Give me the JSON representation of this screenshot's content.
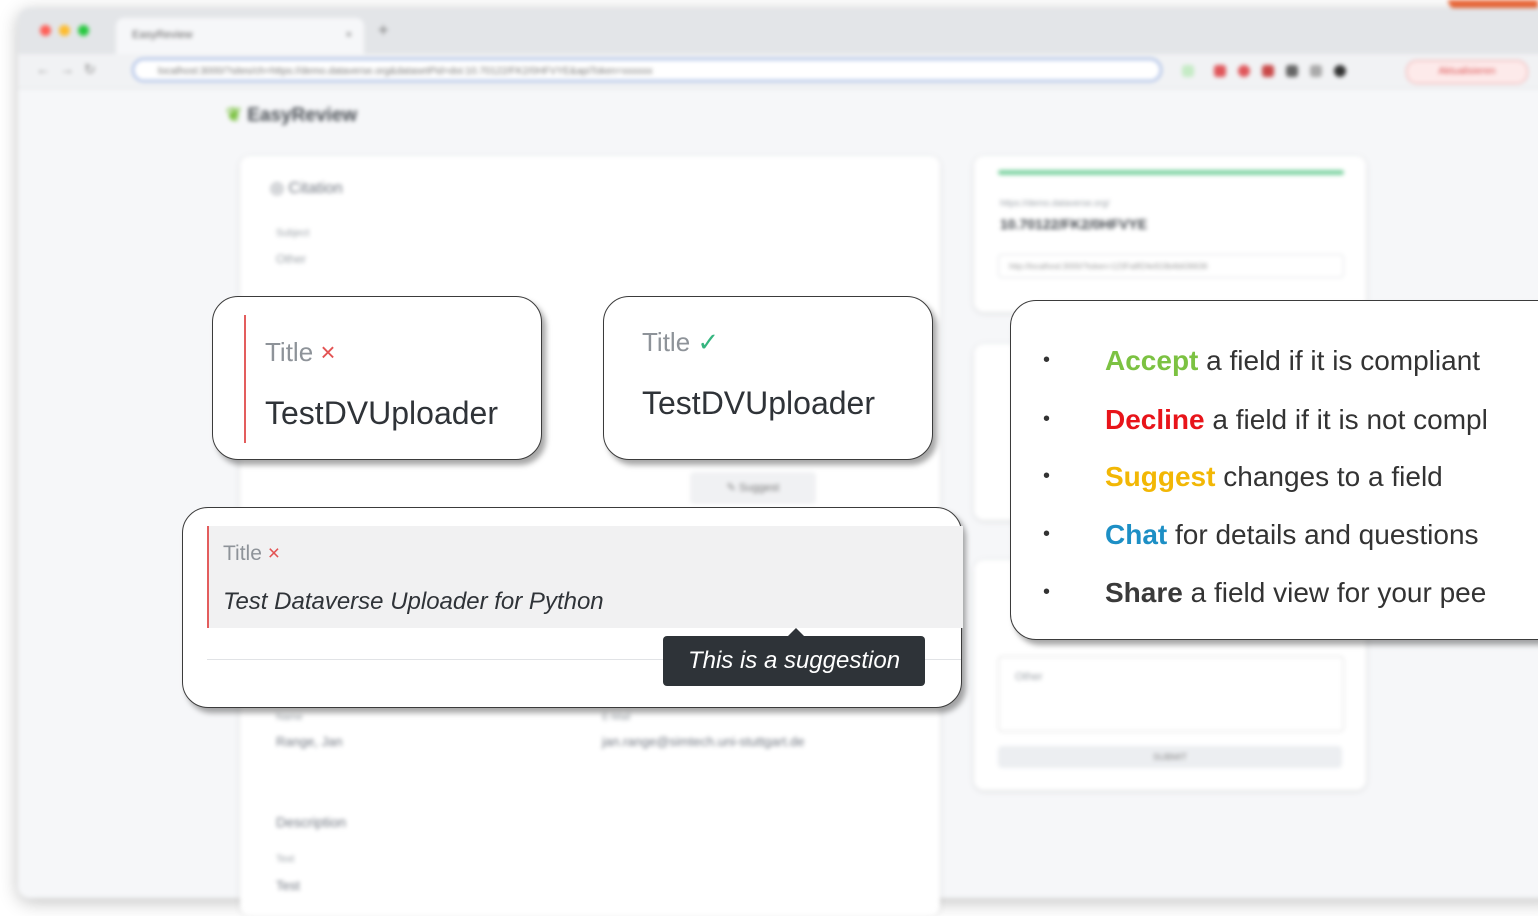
{
  "browser": {
    "tab_title": "EasyReview",
    "tab_close": "×",
    "new_tab": "+",
    "url": "localhost:3000/?sites/ch=https://demo.dataverse.org&datasetPid=doi:10.70122/FK2/0HFVYE&apiToken=xxxxxx",
    "update_label": "Aktualisieren",
    "traffic_colors": [
      "#ff5f57",
      "#febc2e",
      "#28c840"
    ]
  },
  "app": {
    "brand": "EasyReview",
    "section_citation": "Citation",
    "subject_label": "Subject",
    "subject_value": "Other",
    "doi_prefix": "https://demo.dataverse.org/",
    "doi": "10.70122/FK2/0HFVYE",
    "share_link": "http://localhost:3000/?token=123Fa8f24e919b4b636636",
    "suggest_label": "Suggest",
    "name_label": "Name",
    "name_value": "Range, Jan",
    "email_label": "E-Mail",
    "email_value": "jan.range@simtech.uni-stuttgart.de",
    "description_label": "Description",
    "text_label": "Text",
    "text_value": "Test",
    "comment_placeholder": "Other",
    "submit_label": "SUBMIT"
  },
  "callouts": {
    "declined": {
      "label": "Title",
      "mark": "×",
      "value": "TestDVUploader"
    },
    "accepted": {
      "label": "Title",
      "mark": "✓",
      "value": "TestDVUploader"
    },
    "suggestion": {
      "label": "Title",
      "mark": "×",
      "value": "Test Dataverse Uploader for Python",
      "tooltip": "This is a suggestion"
    }
  },
  "legend": {
    "items": [
      {
        "keyword": "Accept",
        "rest": " a field if it is compliant",
        "color": "#7cc242"
      },
      {
        "keyword": "Decline",
        "rest": " a field if it is not compl",
        "color": "#e8141a"
      },
      {
        "keyword": "Suggest",
        "rest": " changes to a field",
        "color": "#f2b705"
      },
      {
        "keyword": "Chat",
        "rest": " for details and questions",
        "color": "#1d8fc5"
      },
      {
        "keyword": "Share",
        "rest": " a field view for your pee",
        "color": "#3a3a3a"
      }
    ]
  }
}
